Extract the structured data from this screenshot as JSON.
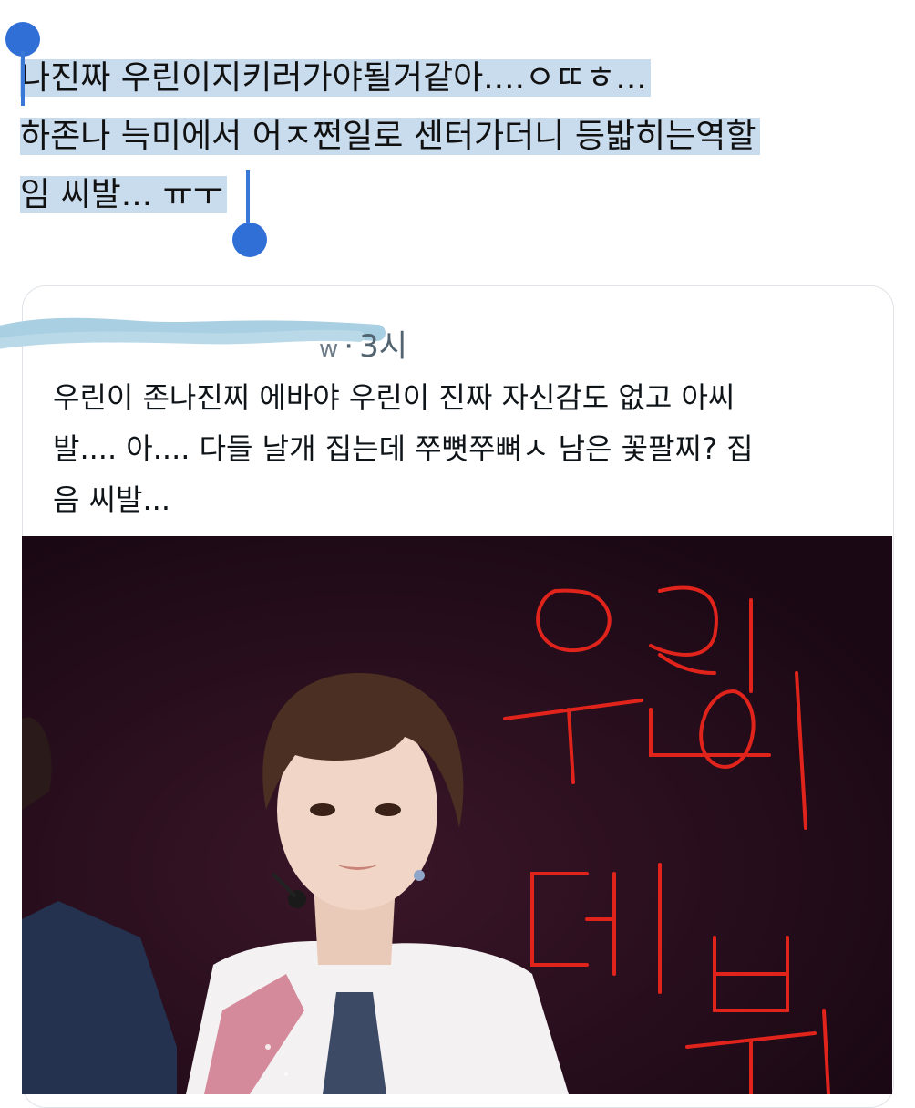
{
  "selected_tweet": {
    "lines": [
      "나진짜 우린이지키러가야될거같아....ㅇㄸㅎ...",
      "하존나 늑미에서 어ㅈ쩐일로 센터가더니 등밟히는역할",
      "임 씨발... ㅠㅜ"
    ]
  },
  "quote": {
    "suffix": "w",
    "time": "3시",
    "text_lines": [
      "우린이 존나진찌 에바야 우린이 진짜 자신감도 없고 아씨",
      "발.... 아.... 다들 날개 집는데 쭈뼛쭈뼈ㅅ 남은 꽃팔찌? 집",
      "음 씨발..."
    ],
    "photo": {
      "handwritten_text": "우린이 데뷔"
    }
  },
  "colors": {
    "selection": "#c9dcee",
    "handle": "#2f6fd6",
    "meta_text": "#536471",
    "annotation": "#e0231b"
  }
}
